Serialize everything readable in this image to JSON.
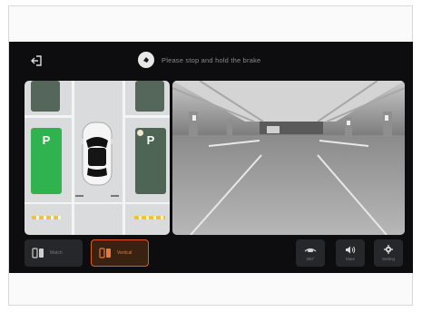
{
  "header": {
    "exit_icon": "exit-icon",
    "notice_icon": "brake-hold-icon",
    "notice_text": "Please stop and hold the brake"
  },
  "overview": {
    "bays": [
      {
        "label": "P",
        "state": "selected",
        "color": "#2fb34f"
      },
      {
        "label": "P",
        "state": "available",
        "color": "#4e6556"
      }
    ],
    "vehicle_icon": "car-top-view-icon"
  },
  "camera": {
    "view": "rear-camera-parking-garage"
  },
  "controls": {
    "left": [
      {
        "id": "mode-a",
        "icon": "parking-mode-icon",
        "label": "Match",
        "active": false
      },
      {
        "id": "mode-b",
        "icon": "parking-mode-icon",
        "label": "Vertical",
        "active": true,
        "accent": "#e05a1c"
      }
    ],
    "right": [
      {
        "id": "view-toggle",
        "icon": "car-view-icon",
        "label": "360°"
      },
      {
        "id": "sound",
        "icon": "speaker-icon",
        "label": "Mute"
      },
      {
        "id": "settings",
        "icon": "gear-icon",
        "label": "Setting"
      }
    ]
  }
}
